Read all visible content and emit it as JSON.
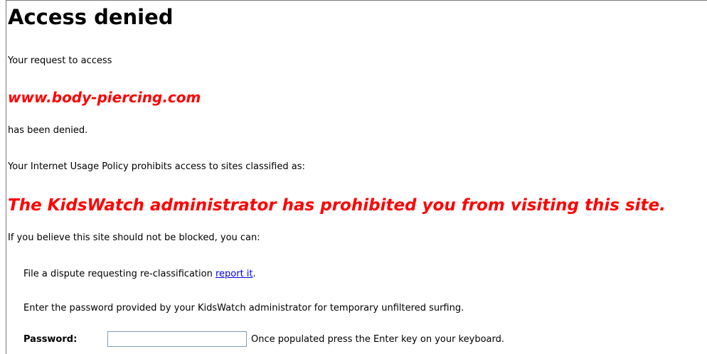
{
  "page": {
    "title": "Access denied",
    "request_text": "Your request to access",
    "site_url": "www.body-piercing.com",
    "denied_text": "has been denied.",
    "policy_text": "Your Internet Usage Policy prohibits access to sites classified as:",
    "reason_text": "The KidsWatch administrator has prohibited you from visiting this site.",
    "believe_text": "If you believe this site should not be blocked, you can:",
    "dispute_text": "File a dispute requesting re-classification",
    "report_link_text": "report it",
    "report_suffix": ".",
    "password_instruction": "Enter the password provided by your KidsWatch administrator for temporary unfiltered surfing.",
    "password_label": "Password:",
    "password_value": "",
    "password_hint": "Once populated press the Enter key on your keyboard."
  },
  "colors": {
    "alert_red": "#ff0000",
    "link_blue": "#0000ee",
    "text": "#000000"
  }
}
